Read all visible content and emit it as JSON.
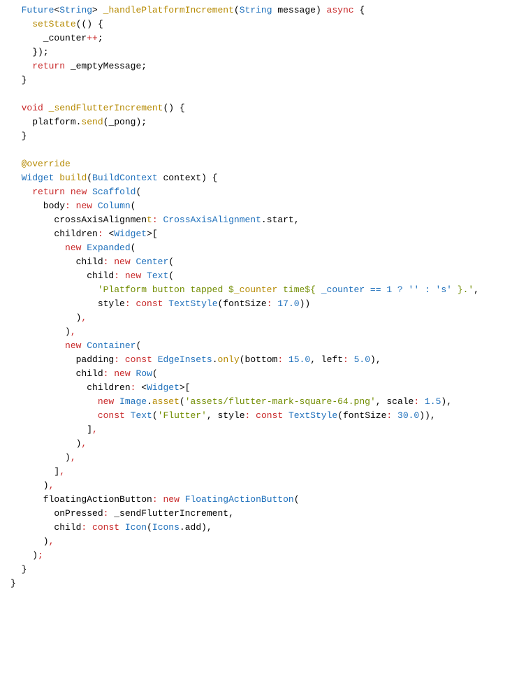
{
  "tokens": [
    [
      [
        "  ",
        ""
      ],
      [
        "Future",
        "type"
      ],
      [
        "<",
        ""
      ],
      [
        "String",
        "type"
      ],
      [
        ">",
        ""
      ],
      [
        " ",
        ""
      ],
      [
        "_handlePlatformIncrement",
        "method"
      ],
      [
        "(",
        ""
      ],
      [
        "String",
        "type"
      ],
      [
        " message) ",
        ""
      ],
      [
        "async",
        "kw"
      ],
      [
        " {",
        ""
      ]
    ],
    [
      [
        "    ",
        ""
      ],
      [
        "setState",
        "method"
      ],
      [
        "(() {",
        ""
      ]
    ],
    [
      [
        "      _counter",
        ""
      ],
      [
        "++",
        "kw"
      ],
      [
        ";",
        ""
      ]
    ],
    [
      [
        "    });",
        ""
      ]
    ],
    [
      [
        "    ",
        ""
      ],
      [
        "return",
        "kw"
      ],
      [
        " _emptyMessage;",
        ""
      ]
    ],
    [
      [
        "  }",
        ""
      ]
    ],
    [
      [
        "",
        ""
      ]
    ],
    [
      [
        "  ",
        ""
      ],
      [
        "void",
        "kw"
      ],
      [
        " ",
        ""
      ],
      [
        "_sendFlutterIncrement",
        "method"
      ],
      [
        "() {",
        ""
      ]
    ],
    [
      [
        "    platform.",
        ""
      ],
      [
        "send",
        "method"
      ],
      [
        "(_pong);",
        ""
      ]
    ],
    [
      [
        "  }",
        ""
      ]
    ],
    [
      [
        "",
        ""
      ]
    ],
    [
      [
        "  ",
        ""
      ],
      [
        "@override",
        "anno"
      ]
    ],
    [
      [
        "  ",
        ""
      ],
      [
        "Widget",
        "type"
      ],
      [
        " ",
        ""
      ],
      [
        "build",
        "method"
      ],
      [
        "(",
        ""
      ],
      [
        "BuildContext",
        "type"
      ],
      [
        " context) {",
        ""
      ]
    ],
    [
      [
        "    ",
        ""
      ],
      [
        "return",
        "kw"
      ],
      [
        " ",
        ""
      ],
      [
        "new",
        "kw"
      ],
      [
        " ",
        ""
      ],
      [
        "Scaffold",
        "type"
      ],
      [
        "(",
        ""
      ]
    ],
    [
      [
        "      body",
        ""
      ],
      [
        ":",
        "kw"
      ],
      [
        " ",
        ""
      ],
      [
        "new",
        "kw"
      ],
      [
        " ",
        ""
      ],
      [
        "Column",
        "type"
      ],
      [
        "(",
        ""
      ]
    ],
    [
      [
        "        crossAxisAlignmen",
        ""
      ],
      [
        "t",
        "method"
      ],
      [
        ":",
        "kw"
      ],
      [
        " ",
        ""
      ],
      [
        "CrossAxisAlignment",
        "type"
      ],
      [
        ".start,",
        ""
      ]
    ],
    [
      [
        "        children",
        ""
      ],
      [
        ":",
        "kw"
      ],
      [
        " <",
        ""
      ],
      [
        "Widget",
        "type"
      ],
      [
        ">[",
        ""
      ]
    ],
    [
      [
        "          ",
        ""
      ],
      [
        "new",
        "kw"
      ],
      [
        " ",
        ""
      ],
      [
        "Expanded",
        "type"
      ],
      [
        "(",
        ""
      ]
    ],
    [
      [
        "            child",
        ""
      ],
      [
        ":",
        "kw"
      ],
      [
        " ",
        ""
      ],
      [
        "new",
        "kw"
      ],
      [
        " ",
        ""
      ],
      [
        "Center",
        "type"
      ],
      [
        "(",
        ""
      ]
    ],
    [
      [
        "              child",
        ""
      ],
      [
        ":",
        "kw"
      ],
      [
        " ",
        ""
      ],
      [
        "new",
        "kw"
      ],
      [
        " ",
        ""
      ],
      [
        "Text",
        "type"
      ],
      [
        "(",
        ""
      ]
    ],
    [
      [
        "                ",
        ""
      ],
      [
        "'Platform button tapped $",
        "str"
      ],
      [
        "_counter",
        "method"
      ],
      [
        " time${",
        "str"
      ],
      [
        " ",
        ""
      ],
      [
        "_counter == 1 ? '' : 's'",
        "type"
      ],
      [
        " ",
        ""
      ],
      [
        "}.'",
        "str"
      ],
      [
        ",",
        ""
      ]
    ],
    [
      [
        "                style",
        ""
      ],
      [
        ":",
        "kw"
      ],
      [
        " ",
        ""
      ],
      [
        "const",
        "kw"
      ],
      [
        " ",
        ""
      ],
      [
        "TextStyle",
        "type"
      ],
      [
        "(fontSize",
        ""
      ],
      [
        ":",
        "kw"
      ],
      [
        " ",
        ""
      ],
      [
        "17.0",
        "num"
      ],
      [
        "))",
        ""
      ]
    ],
    [
      [
        "            )",
        ""
      ],
      [
        ",",
        "kw"
      ]
    ],
    [
      [
        "          )",
        ""
      ],
      [
        ",",
        "kw"
      ]
    ],
    [
      [
        "          ",
        ""
      ],
      [
        "new",
        "kw"
      ],
      [
        " ",
        ""
      ],
      [
        "Container",
        "type"
      ],
      [
        "(",
        ""
      ]
    ],
    [
      [
        "            padding",
        ""
      ],
      [
        ":",
        "kw"
      ],
      [
        " ",
        ""
      ],
      [
        "const",
        "kw"
      ],
      [
        " ",
        ""
      ],
      [
        "EdgeInsets",
        "type"
      ],
      [
        ".",
        ""
      ],
      [
        "only",
        "method"
      ],
      [
        "(bottom",
        ""
      ],
      [
        ":",
        "kw"
      ],
      [
        " ",
        ""
      ],
      [
        "15.0",
        "num"
      ],
      [
        ", left",
        ""
      ],
      [
        ":",
        "kw"
      ],
      [
        " ",
        ""
      ],
      [
        "5.0",
        "num"
      ],
      [
        "),",
        ""
      ]
    ],
    [
      [
        "            child",
        ""
      ],
      [
        ":",
        "kw"
      ],
      [
        " ",
        ""
      ],
      [
        "new",
        "kw"
      ],
      [
        " ",
        ""
      ],
      [
        "Row",
        "type"
      ],
      [
        "(",
        ""
      ]
    ],
    [
      [
        "              children",
        ""
      ],
      [
        ":",
        "kw"
      ],
      [
        " <",
        ""
      ],
      [
        "Widget",
        "type"
      ],
      [
        ">[",
        ""
      ]
    ],
    [
      [
        "                ",
        ""
      ],
      [
        "new",
        "kw"
      ],
      [
        " ",
        ""
      ],
      [
        "Image",
        "type"
      ],
      [
        ".",
        ""
      ],
      [
        "asset",
        "method"
      ],
      [
        "(",
        ""
      ],
      [
        "'assets/flutter-mark-square-64.png'",
        "str"
      ],
      [
        ", scale",
        ""
      ],
      [
        ":",
        "kw"
      ],
      [
        " ",
        ""
      ],
      [
        "1.5",
        "num"
      ],
      [
        "),",
        ""
      ]
    ],
    [
      [
        "                ",
        ""
      ],
      [
        "const",
        "kw"
      ],
      [
        " ",
        ""
      ],
      [
        "Text",
        "type"
      ],
      [
        "(",
        ""
      ],
      [
        "'Flutter'",
        "str"
      ],
      [
        ", style",
        ""
      ],
      [
        ":",
        "kw"
      ],
      [
        " ",
        ""
      ],
      [
        "const",
        "kw"
      ],
      [
        " ",
        ""
      ],
      [
        "TextStyle",
        "type"
      ],
      [
        "(fontSize",
        ""
      ],
      [
        ":",
        "kw"
      ],
      [
        " ",
        ""
      ],
      [
        "30.0",
        "num"
      ],
      [
        ")),",
        ""
      ]
    ],
    [
      [
        "              ]",
        ""
      ],
      [
        ",",
        "kw"
      ]
    ],
    [
      [
        "            )",
        ""
      ],
      [
        ",",
        "kw"
      ]
    ],
    [
      [
        "          )",
        ""
      ],
      [
        ",",
        "kw"
      ]
    ],
    [
      [
        "        ]",
        ""
      ],
      [
        ",",
        "kw"
      ]
    ],
    [
      [
        "      )",
        ""
      ],
      [
        ",",
        "kw"
      ]
    ],
    [
      [
        "      floatingActionButton",
        ""
      ],
      [
        ":",
        "kw"
      ],
      [
        " ",
        ""
      ],
      [
        "new",
        "kw"
      ],
      [
        " ",
        ""
      ],
      [
        "FloatingActionButton",
        "type"
      ],
      [
        "(",
        ""
      ]
    ],
    [
      [
        "        onPressed",
        ""
      ],
      [
        ":",
        "kw"
      ],
      [
        " _sendFlutterIncrement,",
        ""
      ]
    ],
    [
      [
        "        child",
        ""
      ],
      [
        ":",
        "kw"
      ],
      [
        " ",
        ""
      ],
      [
        "const",
        "kw"
      ],
      [
        " ",
        ""
      ],
      [
        "Icon",
        "type"
      ],
      [
        "(",
        ""
      ],
      [
        "Icons",
        "type"
      ],
      [
        ".add),",
        ""
      ]
    ],
    [
      [
        "      )",
        ""
      ],
      [
        ",",
        "kw"
      ]
    ],
    [
      [
        "    )",
        ""
      ],
      [
        ";",
        "kw"
      ]
    ],
    [
      [
        "  }",
        ""
      ]
    ],
    [
      [
        "}",
        ""
      ]
    ]
  ]
}
